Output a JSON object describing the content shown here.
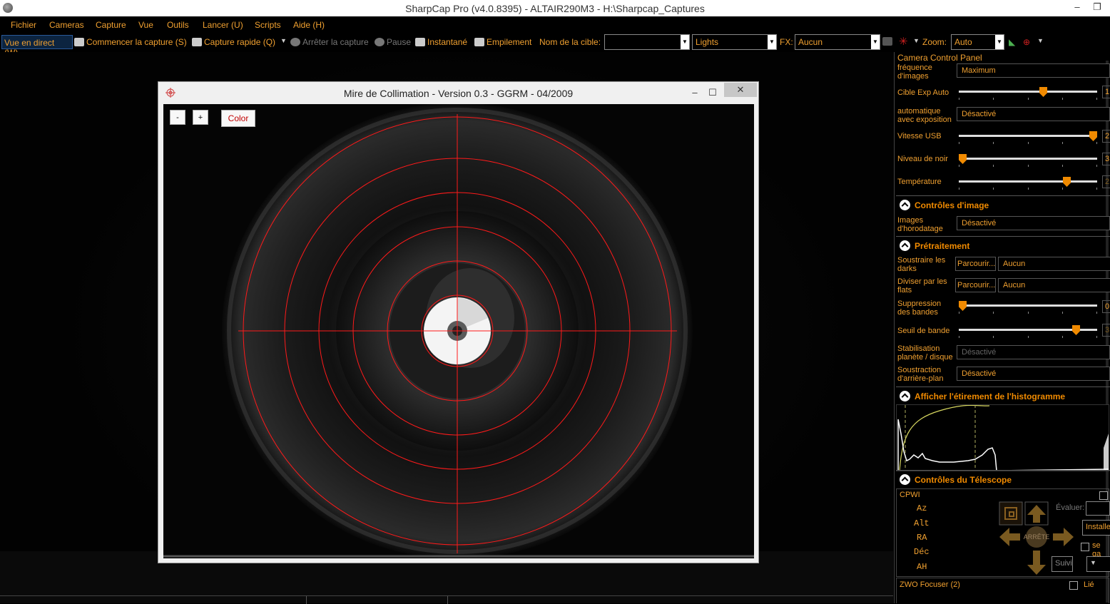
{
  "window": {
    "title": "SharpCap Pro (v4.0.8395) - ALTAIR290M3 - H:\\Sharpcap_Captures",
    "minimize": "–",
    "maximize": "❐",
    "close": "✕"
  },
  "menu": [
    "Fichier",
    "Cameras",
    "Capture",
    "Vue",
    "Outils",
    "Lancer (U)",
    "Scripts",
    "Aide (H)"
  ],
  "toolbar": {
    "live_view": "Vue en direct (W)",
    "start_capture": "Commencer la capture (S)",
    "quick_capture": "Capture rapide (Q)",
    "stop_capture": "Arrêter la capture",
    "pause": "Pause",
    "snapshot": "Instantané",
    "stacking": "Empilement",
    "target_label": "Nom de la cible:",
    "target_value": "",
    "frame_type": "Lights",
    "fx_label": "FX:",
    "fx_value": "Aucun",
    "zoom_label": "Zoom:",
    "zoom_value": "Auto"
  },
  "collimation_window": {
    "title": "Mire de Collimation - Version 0.3 - GGRM - 04/2009",
    "minus_label": "-",
    "plus_label": "+",
    "color_label": "Color",
    "minimize": "–",
    "maximize": "☐",
    "close": "✕"
  },
  "panel": {
    "header": "Camera Control Panel",
    "camera_rows": [
      {
        "label": "fréquence\nd'images",
        "value": "Maximum"
      },
      {
        "label": "Cible Exp Auto",
        "slider": 0.62,
        "value": "1"
      },
      {
        "label": "automatique\navec exposition",
        "value": "Désactivé"
      },
      {
        "label": "Vitesse USB",
        "slider": 1.0,
        "value": "2"
      },
      {
        "label": "Niveau de noir",
        "slider": 0.0,
        "value": "3"
      },
      {
        "label": "Température",
        "slider": 0.8,
        "value": "2"
      }
    ],
    "image_controls": {
      "title": "Contrôles d'image",
      "timestamp_label": "Images\nd'horodatage",
      "timestamp_value": "Désactivé"
    },
    "preprocessing": {
      "title": "Prétraitement",
      "darks_label": "Soustraire les\ndarks",
      "darks_button": "Parcourir...",
      "darks_value": "Aucun",
      "flats_label": "Diviser par les\nflats",
      "flats_button": "Parcourir...",
      "flats_value": "Aucun",
      "banding_label": "Suppression\ndes bandes",
      "banding_value": "0",
      "banding_slider": 0.0,
      "threshold_label": "Seuil de bande",
      "threshold_value": "3",
      "threshold_slider": 0.87,
      "stabilization_label": "Stabilisation\nplanète / disque",
      "stabilization_value": "Désactivé",
      "background_label": "Soustraction\nd'arrière-plan",
      "background_value": "Désactivé"
    },
    "histogram": {
      "title": "Afficher l'étirement de l'histogramme"
    },
    "telescope": {
      "title": "Contrôles du Télescope",
      "mount_name": "CPWI",
      "axes": [
        "Az",
        "Alt",
        "RA",
        "Déc",
        "AH"
      ],
      "stop_label": "ARRÊTE",
      "evaluate_label": "Évaluer:",
      "install_label": "Installe",
      "track_label": "Suivi",
      "keep_label": "se ga"
    },
    "focuser": {
      "name": "ZWO Focuser (2)",
      "linked_label": "Lié"
    }
  },
  "colors": {
    "accent": "#f0a030",
    "section_title": "#f08a00",
    "reticle": "#ff1a1a"
  }
}
